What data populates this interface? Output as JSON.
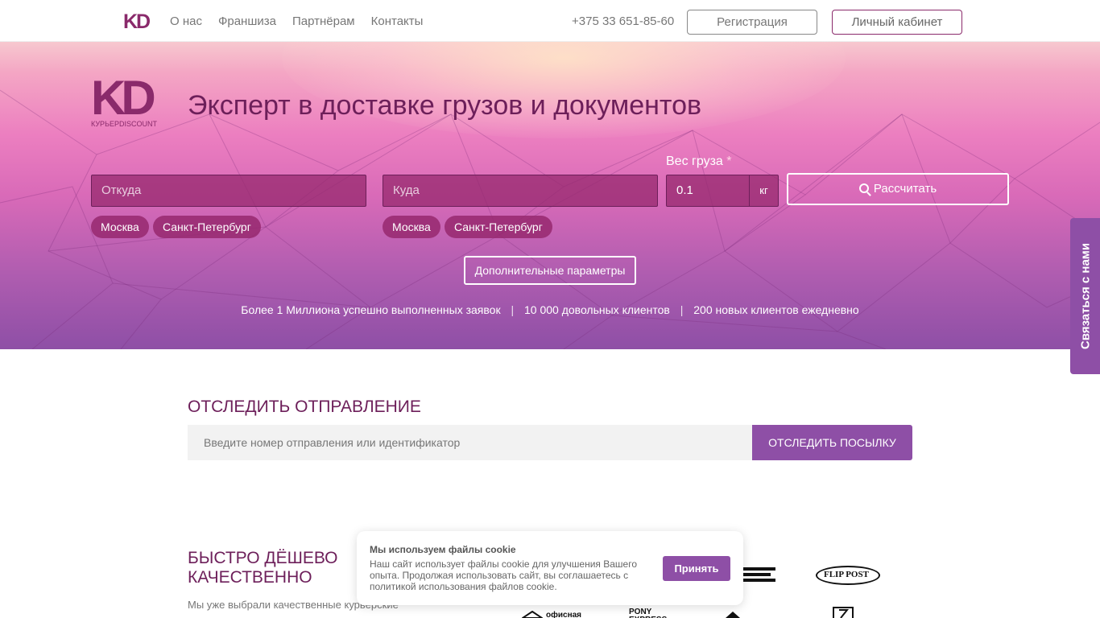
{
  "nav": {
    "logo": "KD",
    "links": [
      "О нас",
      "Франшиза",
      "Партнёрам",
      "Контакты"
    ],
    "phone": "+375 33 651-85-60",
    "register_label": "Регистрация",
    "cabinet_label": "Личный кабинет"
  },
  "hero": {
    "logo_text": "KD",
    "logo_sub": "КУРЬЕРDISCOUNT",
    "title": "Эксперт в доставке грузов и документов",
    "from_placeholder": "Откуда",
    "to_placeholder": "Куда",
    "weight_label": "Вес груза",
    "weight_required": "*",
    "weight_value": "0.1",
    "weight_unit": "кг",
    "calc_label": "Рассчитать",
    "from_chips": [
      "Москва",
      "Санкт-Петербург"
    ],
    "to_chips": [
      "Москва",
      "Санкт-Петербург"
    ],
    "more_label": "Дополнительные параметры",
    "stats": [
      "Более 1 Миллиона успешно выполненных заявок",
      "10 000 довольных клиентов",
      "200 новых клиентов ежедневно"
    ],
    "stat_separator": "|"
  },
  "contact_tab": "Связаться с нами",
  "tracking": {
    "title": "ОТСЛЕДИТЬ ОТПРАВЛЕНИЕ",
    "placeholder": "Введите номер отправления или идентификатор",
    "button": "ОТСЛЕДИТЬ ПОСЫЛКУ"
  },
  "features": {
    "title_line1": "БЫСТРО ДЁШЕВО",
    "title_line2": "КАЧЕСТВЕННО",
    "text": "Мы уже выбрали качественные курьерские службы и заключили с ними договоры. Вам"
  },
  "partners": [
    "FLIP POST",
    "офисная",
    "PONY EXPRESS"
  ],
  "cookie": {
    "title": "Мы используем файлы cookie",
    "text": "Наш сайт использует файлы cookie для улучшения Вашего опыта. Продолжая использовать сайт, вы соглашаетесь с политикой использования файлов cookie.",
    "accept": "Принять"
  },
  "colors": {
    "brand": "#8a2a6b",
    "accent": "#8e4fa6",
    "title": "#6d1f5a"
  }
}
